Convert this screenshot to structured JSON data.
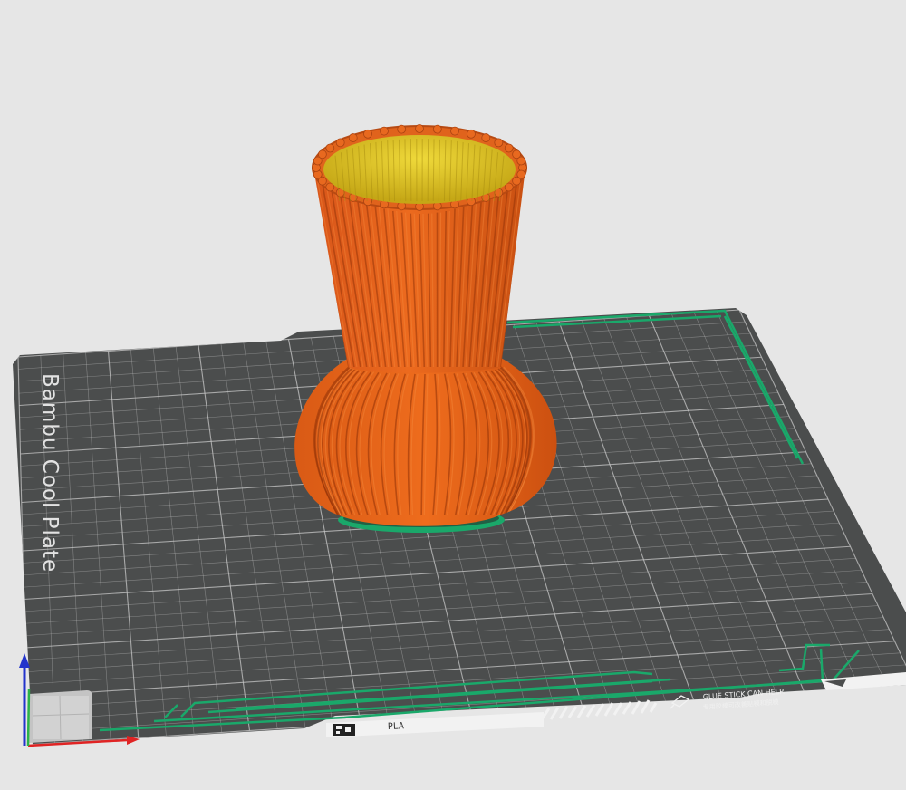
{
  "viewport": {
    "background": "#e6e6e6"
  },
  "build_plate": {
    "name_label": "Bambu Cool Plate",
    "filament_label": "PLA",
    "notice_line_1": "GLUE STICK CAN HELP.",
    "notice_line_2": "专用胶棒可改善贴模和脱模",
    "surface_color": "#4b4d4d",
    "grid_color": "#c8c8c8",
    "accent_color": "#1aa86a"
  },
  "model": {
    "object": "vase",
    "filament_color": "#e2601a",
    "inner_color": "#d9c21c"
  },
  "axes": {
    "x_color": "#e02424",
    "y_color": "#2bb24a",
    "z_color": "#2233cc"
  }
}
